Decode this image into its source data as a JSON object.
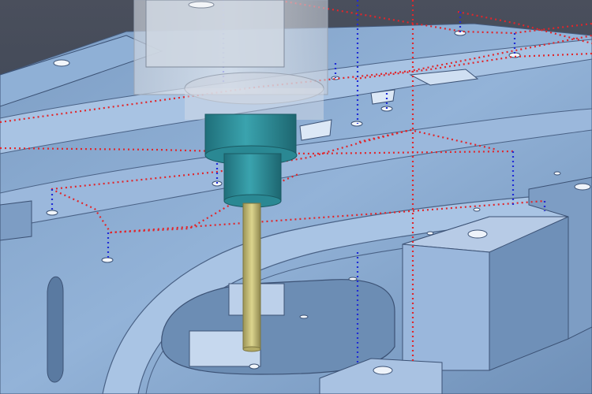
{
  "viewport": {
    "kind": "3d-cam-toolpath-simulation",
    "background_color": "#3a4658",
    "part_color": "#8fb0d6",
    "part_shadow_color": "#5f7ea3",
    "part_highlight_color": "#c9d9ee",
    "holder_color": "#d7dde6",
    "spindle_color": "#2f8f9a",
    "tool_color": "#c9c27a",
    "toolpath_rapid_color": "#e0262b",
    "toolpath_plunge_color": "#1f2bd6"
  }
}
